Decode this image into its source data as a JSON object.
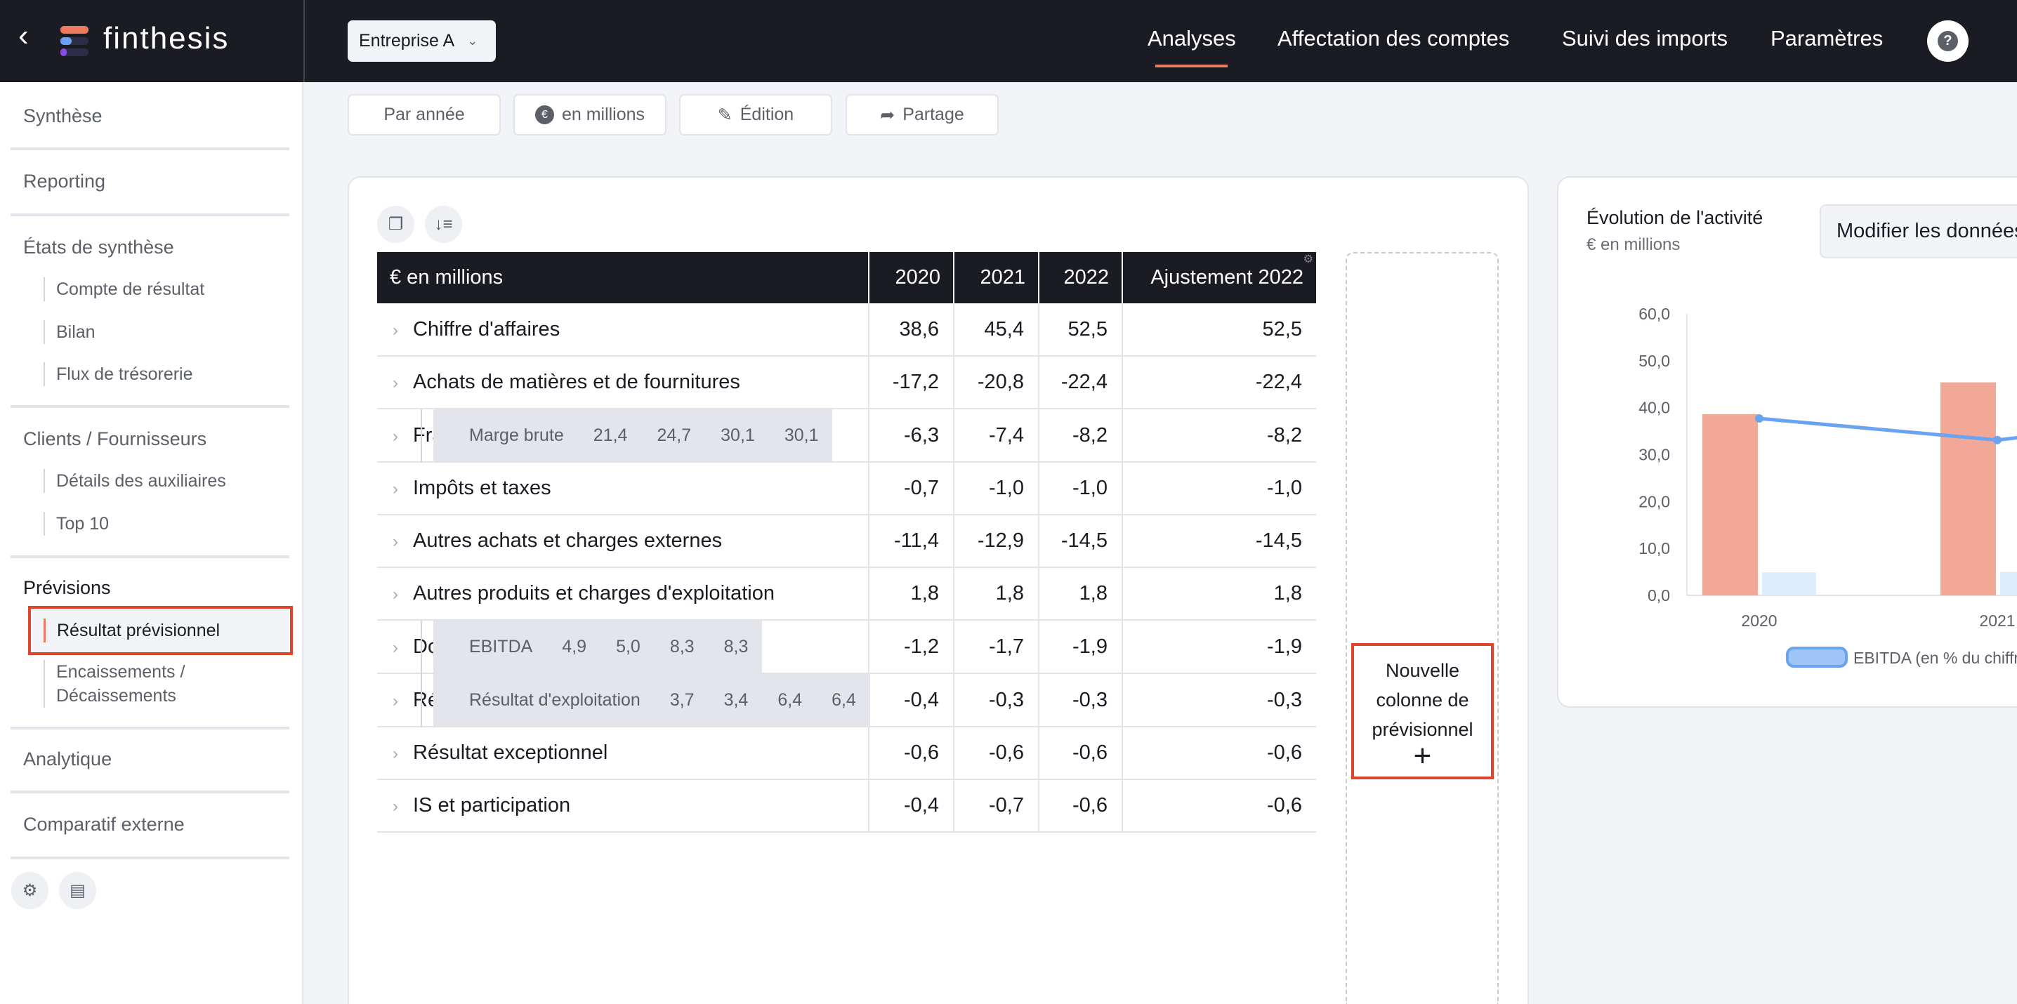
{
  "brand": {
    "name": "finthesis",
    "logo_colors": [
      "#ef7b5e",
      "#6aa3f2",
      "#8b4ce6"
    ]
  },
  "company_select": {
    "value": "Entreprise A"
  },
  "nav": {
    "items": [
      "Analyses",
      "Affectation des comptes",
      "Suivi des imports",
      "Paramètres"
    ],
    "active": "Analyses",
    "accent": "#ef7b5e"
  },
  "sidebar": {
    "synthese": "Synthèse",
    "reporting": "Reporting",
    "etats": "États de synthèse",
    "etats_items": [
      "Compte de résultat",
      "Bilan",
      "Flux de trésorerie"
    ],
    "clients": "Clients / Fournisseurs",
    "clients_items": [
      "Détails des auxiliaires",
      "Top 10"
    ],
    "previsions": "Prévisions",
    "previsions_items": [
      "Résultat prévisionnel",
      "Encaissements /",
      "Décaissements"
    ],
    "analytique": "Analytique",
    "comparatif": "Comparatif externe"
  },
  "toolbar": {
    "par_annee": "Par année",
    "millions": "en millions",
    "edition": "Édition",
    "partage": "Partage"
  },
  "table": {
    "headers": [
      "€ en millions",
      "2020",
      "2021",
      "2022",
      "Ajustement 2022"
    ],
    "rows": [
      {
        "label": "Chiffre d'affaires",
        "values": [
          "38,6",
          "45,4",
          "52,5",
          "52,5"
        ],
        "expandable": true
      },
      {
        "label": "Achats de matières et de fournitures",
        "values": [
          "-17,2",
          "-20,8",
          "-22,4",
          "-22,4"
        ],
        "expandable": true
      },
      {
        "label": "Marge brute",
        "values": [
          "21,4",
          "24,7",
          "30,1",
          "30,1"
        ],
        "subtotal": true
      },
      {
        "label": "Frais de personnel",
        "values": [
          "-6,3",
          "-7,4",
          "-8,2",
          "-8,2"
        ],
        "expandable": true
      },
      {
        "label": "Impôts et taxes",
        "values": [
          "-0,7",
          "-1,0",
          "-1,0",
          "-1,0"
        ],
        "expandable": true
      },
      {
        "label": "Autres achats et charges externes",
        "values": [
          "-11,4",
          "-12,9",
          "-14,5",
          "-14,5"
        ],
        "expandable": true
      },
      {
        "label": "Autres produits et charges d'exploitation",
        "values": [
          "1,8",
          "1,8",
          "1,8",
          "1,8"
        ],
        "expandable": true
      },
      {
        "label": "EBITDA",
        "values": [
          "4,9",
          "5,0",
          "8,3",
          "8,3"
        ],
        "subtotal": true
      },
      {
        "label": "Dotation/reprises aux amort. et prov.",
        "values": [
          "-1,2",
          "-1,7",
          "-1,9",
          "-1,9"
        ],
        "expandable": true
      },
      {
        "label": "Résultat d'exploitation",
        "values": [
          "3,7",
          "3,4",
          "6,4",
          "6,4"
        ],
        "subtotal": true
      },
      {
        "label": "Résultat financier",
        "values": [
          "-0,4",
          "-0,3",
          "-0,3",
          "-0,3"
        ],
        "expandable": true
      },
      {
        "label": "Résultat exceptionnel",
        "values": [
          "-0,6",
          "-0,6",
          "-0,6",
          "-0,6"
        ],
        "expandable": true
      },
      {
        "label": "IS et participation",
        "values": [
          "-0,4",
          "-0,7",
          "-0,6",
          "-0,6"
        ],
        "expandable": true
      }
    ]
  },
  "new_column": {
    "label": "Nouvelle colonne de prévisionnel",
    "plus": "+"
  },
  "chart_card": {
    "title": "Évolution de l'activité",
    "subtitle": "€ en millions",
    "edit_button": "Modifier les données"
  },
  "chart_data": {
    "type": "bar",
    "categories": [
      "2020",
      "2021"
    ],
    "series": [
      {
        "values": [
          38.6,
          45.4
        ],
        "color": "#f2a897"
      },
      {
        "values": [
          4.9,
          5.0
        ],
        "color": "#deebfb"
      },
      {
        "name": "EBITDA (en % du chiffre d'affaires)",
        "type": "line",
        "values": [
          37.7,
          33.1
        ],
        "color": "#6aa3f2"
      }
    ],
    "yticks": [
      "0,0",
      "10,0",
      "20,0",
      "30,0",
      "40,0",
      "50,0",
      "60,0"
    ],
    "ylim": [
      0,
      60
    ],
    "grid": false,
    "legend": "bottom"
  }
}
